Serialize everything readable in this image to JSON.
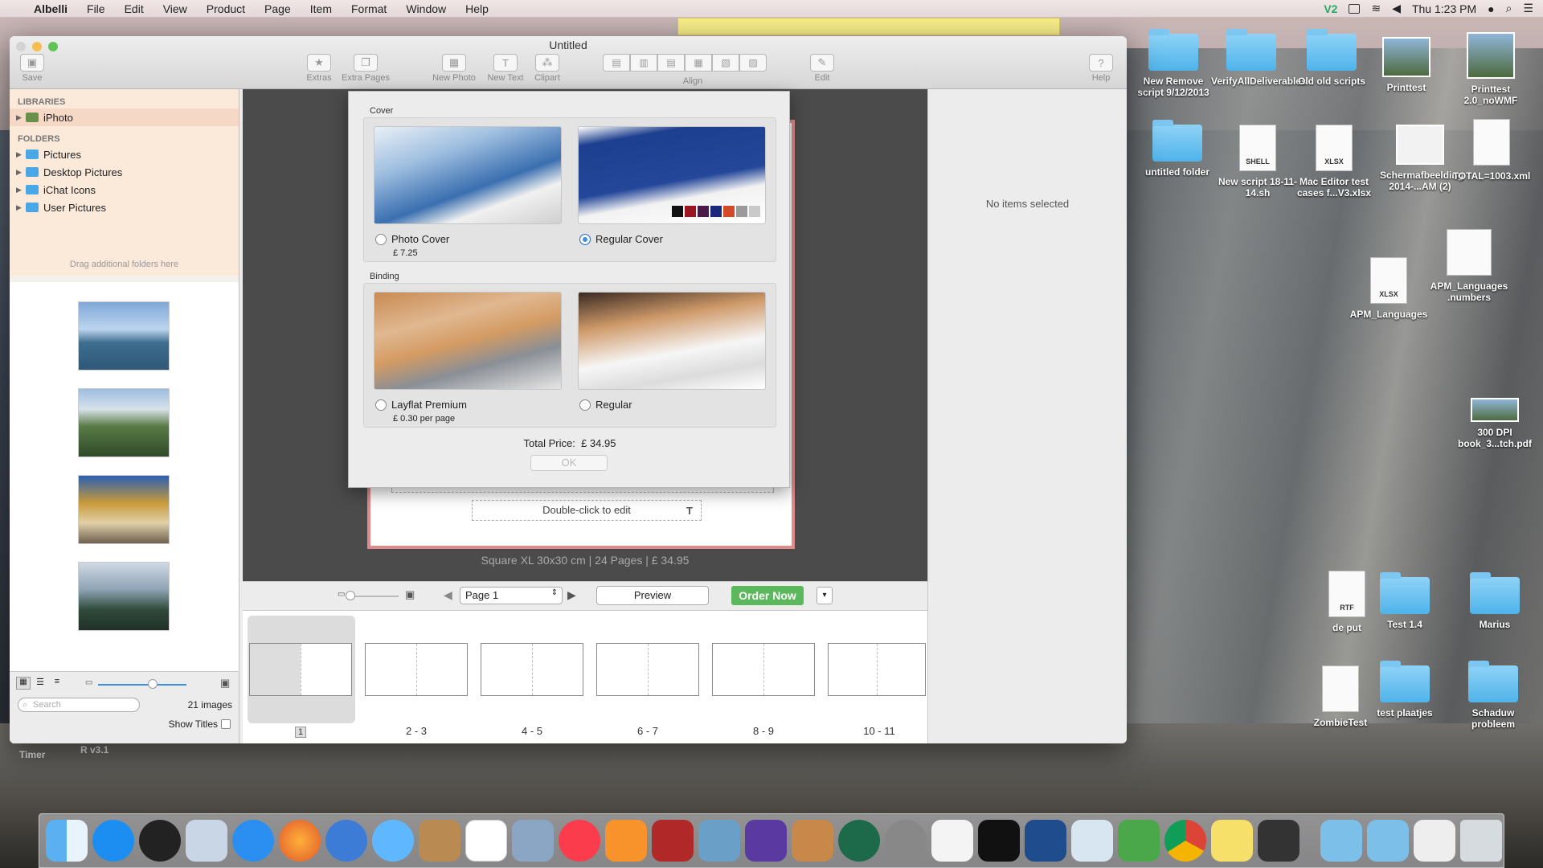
{
  "menubar": {
    "app_name": "Albelli",
    "menus": [
      "File",
      "Edit",
      "View",
      "Product",
      "Page",
      "Item",
      "Format",
      "Window",
      "Help"
    ],
    "clock": "Thu 1:23 PM",
    "status_text": "V2"
  },
  "window": {
    "title": "Untitled",
    "toolbar": {
      "save": "Save",
      "extras": "Extras",
      "extra_pages": "Extra Pages",
      "new_photo": "New Photo",
      "new_text": "New Text",
      "clipart": "Clipart",
      "align": "Align",
      "edit": "Edit",
      "help": "Help"
    },
    "sidebar": {
      "libraries_header": "LIBRARIES",
      "iphoto": "iPhoto",
      "folders_header": "FOLDERS",
      "folders": [
        "Pictures",
        "Desktop Pictures",
        "iChat Icons",
        "User Pictures"
      ],
      "drag_hint": "Drag additional folders here",
      "search_placeholder": "Search",
      "image_count": "21 images",
      "show_titles": "Show Titles"
    },
    "dialog": {
      "cover_header": "Cover",
      "binding_header": "Binding",
      "photo_cover": "Photo Cover",
      "photo_cover_price": "£ 7.25",
      "regular_cover": "Regular Cover",
      "layflat": "Layflat Premium",
      "layflat_price": "£ 0.30 per page",
      "regular_binding": "Regular",
      "total_label": "Total Price:",
      "total_value": "£ 34.95",
      "ok": "OK"
    },
    "canvas": {
      "double_click": "Double-click to edit",
      "page_info": "Square XL 30x30 cm  |  24 Pages  |  £ 34.95"
    },
    "right_panel": {
      "empty": "No items selected"
    },
    "nav": {
      "page_select": "Page 1",
      "preview": "Preview",
      "order_now": "Order Now"
    },
    "filmstrip": [
      "1",
      "2 - 3",
      "4 - 5",
      "6 - 7",
      "8 - 9",
      "10 - 11"
    ]
  },
  "desktop": {
    "icons": [
      "New Remove script 9/12/2013",
      "VerifyAllDeliverables",
      "Old old scripts",
      "Printtest",
      "Printtest 2.0_noWMF",
      "untitled folder",
      "New script 18-11-14.sh",
      "Mac Editor test cases f...V3.xlsx",
      "Schermafbeelding 2014-...AM (2)",
      "TOTAL=1003.xml",
      "APM_Languages",
      "APM_Languages .numbers",
      "300 DPI book_3...tch.pdf",
      "de put",
      "Test 1.4",
      "Marius",
      "ZombieTest",
      "test plaatjes",
      "Schaduw probleem"
    ],
    "timer": "Timer",
    "version": "R v3.1"
  }
}
